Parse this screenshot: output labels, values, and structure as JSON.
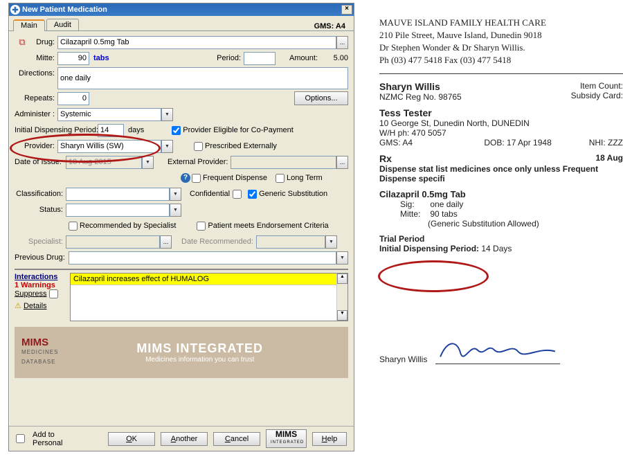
{
  "window": {
    "title": "New Patient Medication",
    "gms": "GMS: A4",
    "tabs": {
      "main": "Main",
      "audit": "Audit"
    }
  },
  "form": {
    "drug_label": "Drug:",
    "drug_value": "Cilazapril 0.5mg Tab",
    "mitte_label": "Mitte:",
    "mitte_value": "90",
    "mitte_unit": "tabs",
    "period_label": "Period:",
    "period_value": "",
    "amount_label": "Amount:",
    "amount_value": "5.00",
    "directions_label": "Directions:",
    "directions_value": "one daily",
    "repeats_label": "Repeats:",
    "repeats_value": "0",
    "options_label": "Options...",
    "administer_label": "Administer :",
    "administer_value": "Systemic",
    "idp_label": "Initial Dispensing Period:",
    "idp_value": "14",
    "idp_unit": "days",
    "copay_label": "Provider Eligible for Co-Payment",
    "provider_label": "Provider:",
    "provider_value": "Sharyn Willis (SW)",
    "ext_label": "Prescribed Externally",
    "doi_label": "Date of Issue:",
    "doi_value": "18 Aug 2015",
    "extprov_label": "External Provider:",
    "extprov_value": "",
    "freq_label": "Frequent Dispense",
    "longterm_label": "Long Term",
    "class_label": "Classification:",
    "conf_label": "Confidential",
    "gensub_label": "Generic Substitution",
    "status_label": "Status:",
    "recspec_label": "Recommended by Specialist",
    "endorse_label": "Patient meets Endorsement Criteria",
    "specialist_label": "Specialist:",
    "daterec_label": "Date Recommended:",
    "prevdrug_label": "Previous Drug:"
  },
  "interactions": {
    "header": "Interactions",
    "warnings": "1 Warnings",
    "suppress": "Suppress",
    "details": "Details",
    "text": "Cilazapril increases effect of HUMALOG"
  },
  "mims": {
    "left1": "MIMS",
    "left2": "MEDICINES",
    "left3": "DATABASE",
    "right1": "MIMS INTEGRATED",
    "right2": "Medicines information you can trust"
  },
  "buttons": {
    "add_personal": "Add to Personal",
    "ok": "OK",
    "another": "Another",
    "cancel": "Cancel",
    "mims": "MIMS",
    "mims_sub": "INTEGRATED",
    "help": "Help"
  },
  "rx": {
    "clinic": "MAUVE ISLAND FAMILY HEALTH CARE",
    "addr": "210 Pile Street, Mauve Island, Dunedin 9018",
    "drs": "Dr Stephen Wonder & Dr Sharyn Willis.",
    "phone": "Ph (03) 477 5418 Fax (03) 477 5418",
    "prov_name": "Sharyn Willis",
    "prov_reg": "NZMC Reg No. 98765",
    "item_count": "Item Count:",
    "subsidy": "Subsidy Card:",
    "patient": "Tess Tester",
    "pat_addr": "10 George St, Dunedin North, DUNEDIN",
    "pat_ph": "W/H ph: 470 5057",
    "gms": "GMS: A4",
    "dob": "DOB: 17 Apr 1948",
    "nhi": "NHI: ZZZ",
    "rx_label": "Rx",
    "rx_date": "18 Aug",
    "note": "Dispense stat list medicines once only unless Frequent Dispense specifi",
    "drug": "Cilazapril 0.5mg Tab",
    "sig_lbl": "Sig:",
    "sig_val": "one daily",
    "mitte_lbl": "Mitte:",
    "mitte_val": "90 tabs",
    "gensub": "(Generic Substitution Allowed)",
    "trial": "Trial Period",
    "idp_lbl": "Initial Dispensing Period:",
    "idp_val": "14 Days",
    "sig_name": "Sharyn Willis"
  }
}
